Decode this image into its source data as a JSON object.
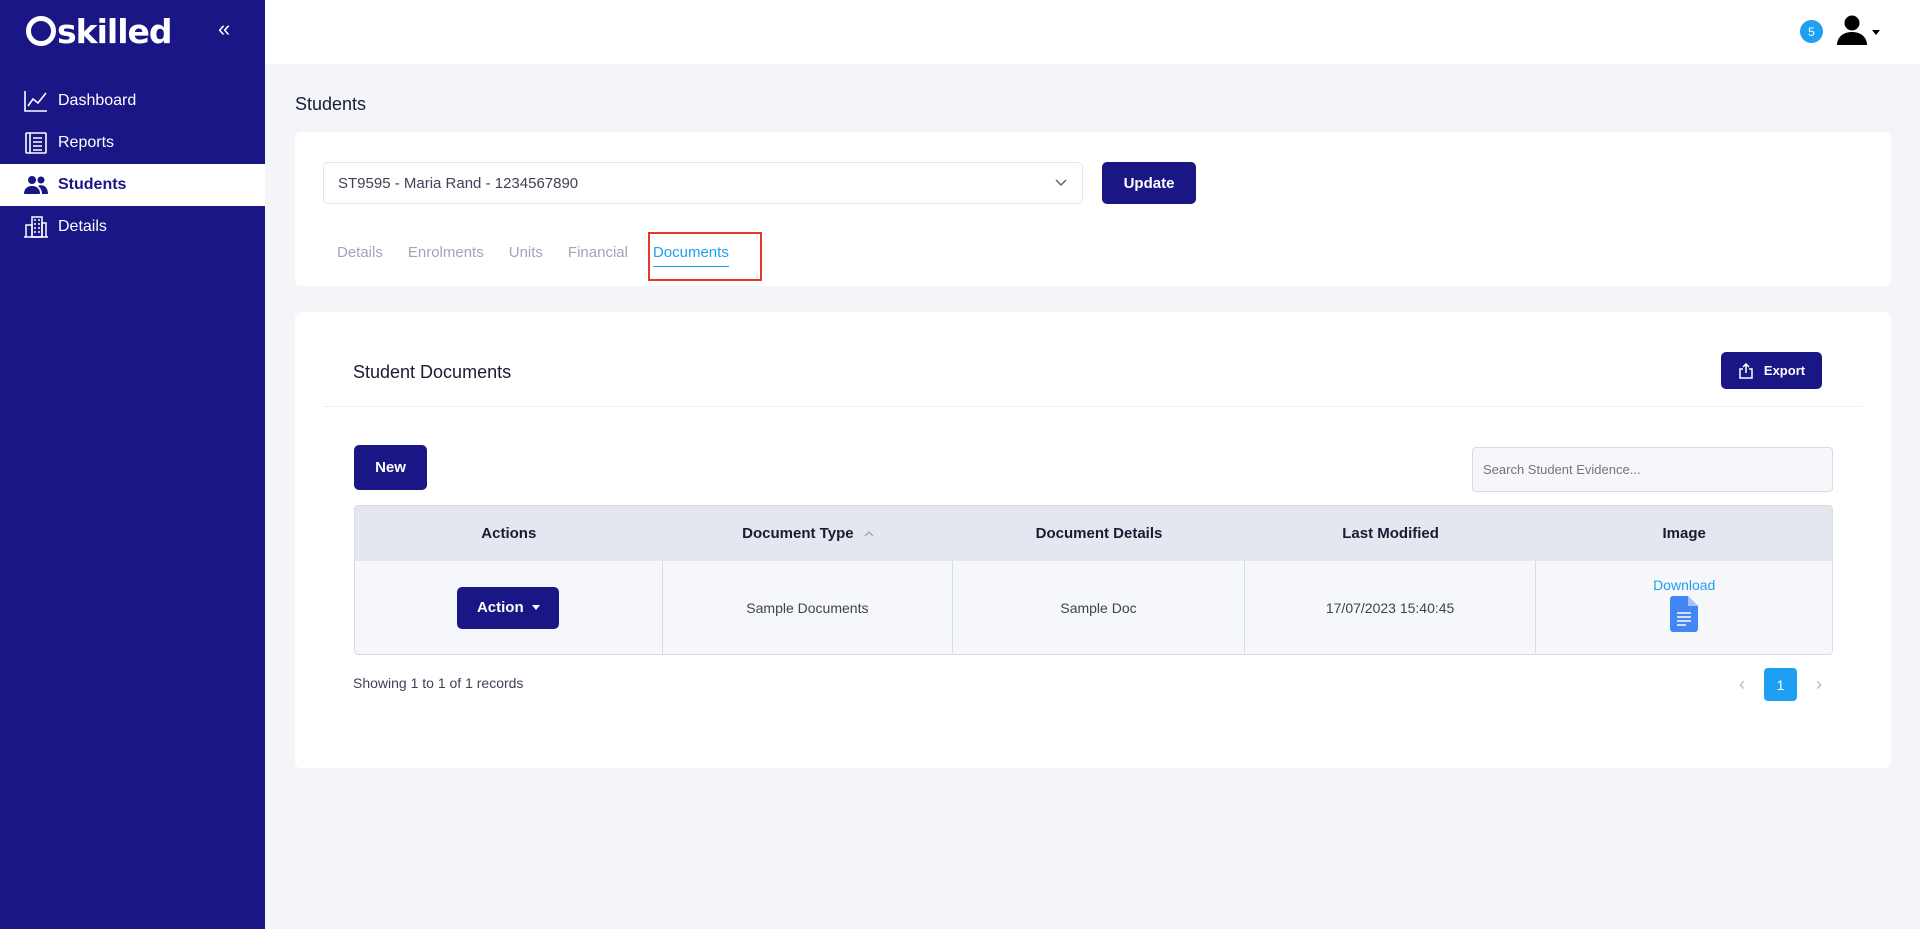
{
  "sidebar": {
    "brand": "skilled",
    "items": [
      {
        "label": "Dashboard",
        "icon": "chart-line-icon"
      },
      {
        "label": "Reports",
        "icon": "reports-icon"
      },
      {
        "label": "Students",
        "icon": "users-icon"
      },
      {
        "label": "Details",
        "icon": "building-icon"
      }
    ],
    "active_index": 2
  },
  "topbar": {
    "notification_count": "5"
  },
  "page": {
    "title": "Students"
  },
  "student_selector": {
    "value": "ST9595 - Maria Rand - 1234567890",
    "update_label": "Update"
  },
  "tabs": [
    "Details",
    "Enrolments",
    "Units",
    "Financial",
    "Documents"
  ],
  "active_tab": "Documents",
  "documents": {
    "title": "Student Documents",
    "export_label": "Export",
    "new_label": "New",
    "search_placeholder": "Search Student Evidence...",
    "columns": [
      "Actions",
      "Document Type",
      "Document Details",
      "Last Modified",
      "Image"
    ],
    "rows": [
      {
        "action_label": "Action",
        "document_type": "Sample Documents",
        "document_details": "Sample Doc",
        "last_modified": "17/07/2023 15:40:45",
        "image_link": "Download"
      }
    ],
    "showing_text": "Showing 1 to 1 of 1 records",
    "current_page": "1"
  },
  "colors": {
    "sidebar": "#1b1685",
    "accent": "#1e9ff2",
    "highlight": "#e5392b"
  }
}
